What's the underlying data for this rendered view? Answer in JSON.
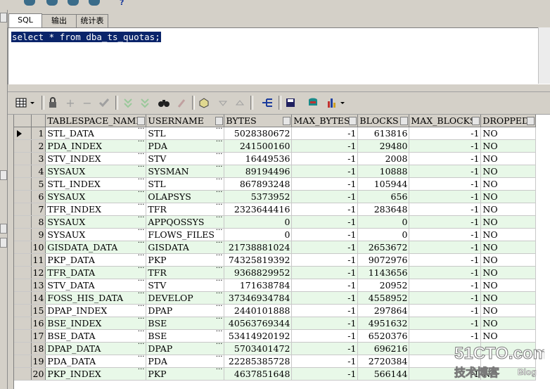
{
  "tabs": [
    {
      "label": "SQL",
      "active": true
    },
    {
      "label": "输出",
      "active": false
    },
    {
      "label": "统计表",
      "active": false
    }
  ],
  "editor": {
    "query": "select * from dba_ts_quotas;"
  },
  "toolbar": {
    "icons": [
      "grid-menu-icon",
      "lock-icon",
      "add-record-icon",
      "delete-record-icon",
      "post-record-icon",
      "first-record-icon",
      "last-record-icon",
      "find-icon",
      "clear-icon",
      "query-by-example-icon",
      "next-page-icon",
      "prev-page-icon",
      "link-icon",
      "save-icon",
      "export-icon",
      "chart-icon"
    ]
  },
  "grid": {
    "columns": [
      "TABLESPACE_NAME",
      "USERNAME",
      "BYTES",
      "MAX_BYTES",
      "BLOCKS",
      "MAX_BLOCKS",
      "DROPPED"
    ],
    "rows": [
      {
        "n": "1",
        "ts": "STL_DATA",
        "user": "STL",
        "bytes": "5028380672",
        "max_bytes": "-1",
        "blocks": "613816",
        "max_blocks": "-1",
        "dropped": "NO"
      },
      {
        "n": "2",
        "ts": "PDA_INDEX",
        "user": "PDA",
        "bytes": "241500160",
        "max_bytes": "-1",
        "blocks": "29480",
        "max_blocks": "-1",
        "dropped": "NO"
      },
      {
        "n": "3",
        "ts": "STV_INDEX",
        "user": "STV",
        "bytes": "16449536",
        "max_bytes": "-1",
        "blocks": "2008",
        "max_blocks": "-1",
        "dropped": "NO"
      },
      {
        "n": "4",
        "ts": "SYSAUX",
        "user": "SYSMAN",
        "bytes": "89194496",
        "max_bytes": "-1",
        "blocks": "10888",
        "max_blocks": "-1",
        "dropped": "NO"
      },
      {
        "n": "5",
        "ts": "STL_INDEX",
        "user": "STL",
        "bytes": "867893248",
        "max_bytes": "-1",
        "blocks": "105944",
        "max_blocks": "-1",
        "dropped": "NO"
      },
      {
        "n": "6",
        "ts": "SYSAUX",
        "user": "OLAPSYS",
        "bytes": "5373952",
        "max_bytes": "-1",
        "blocks": "656",
        "max_blocks": "-1",
        "dropped": "NO"
      },
      {
        "n": "7",
        "ts": "TFR_INDEX",
        "user": "TFR",
        "bytes": "2323644416",
        "max_bytes": "-1",
        "blocks": "283648",
        "max_blocks": "-1",
        "dropped": "NO"
      },
      {
        "n": "8",
        "ts": "SYSAUX",
        "user": "APPQOSSYS",
        "bytes": "0",
        "max_bytes": "-1",
        "blocks": "0",
        "max_blocks": "-1",
        "dropped": "NO"
      },
      {
        "n": "9",
        "ts": "SYSAUX",
        "user": "FLOWS_FILES",
        "bytes": "0",
        "max_bytes": "-1",
        "blocks": "0",
        "max_blocks": "-1",
        "dropped": "NO"
      },
      {
        "n": "10",
        "ts": "GISDATA_DATA",
        "user": "GISDATA",
        "bytes": "21738881024",
        "max_bytes": "-1",
        "blocks": "2653672",
        "max_blocks": "-1",
        "dropped": "NO"
      },
      {
        "n": "11",
        "ts": "PKP_DATA",
        "user": "PKP",
        "bytes": "74325819392",
        "max_bytes": "-1",
        "blocks": "9072976",
        "max_blocks": "-1",
        "dropped": "NO"
      },
      {
        "n": "12",
        "ts": "TFR_DATA",
        "user": "TFR",
        "bytes": "9368829952",
        "max_bytes": "-1",
        "blocks": "1143656",
        "max_blocks": "-1",
        "dropped": "NO"
      },
      {
        "n": "13",
        "ts": "STV_DATA",
        "user": "STV",
        "bytes": "171638784",
        "max_bytes": "-1",
        "blocks": "20952",
        "max_blocks": "-1",
        "dropped": "NO"
      },
      {
        "n": "14",
        "ts": "FOSS_HIS_DATA",
        "user": "DEVELOP",
        "bytes": "37346934784",
        "max_bytes": "-1",
        "blocks": "4558952",
        "max_blocks": "-1",
        "dropped": "NO"
      },
      {
        "n": "15",
        "ts": "DPAP_INDEX",
        "user": "DPAP",
        "bytes": "2440101888",
        "max_bytes": "-1",
        "blocks": "297864",
        "max_blocks": "-1",
        "dropped": "NO"
      },
      {
        "n": "16",
        "ts": "BSE_INDEX",
        "user": "BSE",
        "bytes": "40563769344",
        "max_bytes": "-1",
        "blocks": "4951632",
        "max_blocks": "-1",
        "dropped": "NO"
      },
      {
        "n": "17",
        "ts": "BSE_DATA",
        "user": "BSE",
        "bytes": "53414920192",
        "max_bytes": "-1",
        "blocks": "6520376",
        "max_blocks": "-1",
        "dropped": "NO"
      },
      {
        "n": "18",
        "ts": "DPAP_DATA",
        "user": "DPAP",
        "bytes": "5703401472",
        "max_bytes": "-1",
        "blocks": "696216",
        "max_blocks": "",
        "dropped": ""
      },
      {
        "n": "19",
        "ts": "PDA_DATA",
        "user": "PDA",
        "bytes": "22285385728",
        "max_bytes": "-1",
        "blocks": "2720384",
        "max_blocks": "",
        "dropped": ""
      },
      {
        "n": "20",
        "ts": "PKP_INDEX",
        "user": "PKP",
        "bytes": "4637851648",
        "max_bytes": "-1",
        "blocks": "566144",
        "max_blocks": "-1",
        "dropped": "NO"
      }
    ]
  },
  "watermark": {
    "line1": "51CTO.com",
    "line2": "技术博客",
    "line3": "Blog"
  }
}
